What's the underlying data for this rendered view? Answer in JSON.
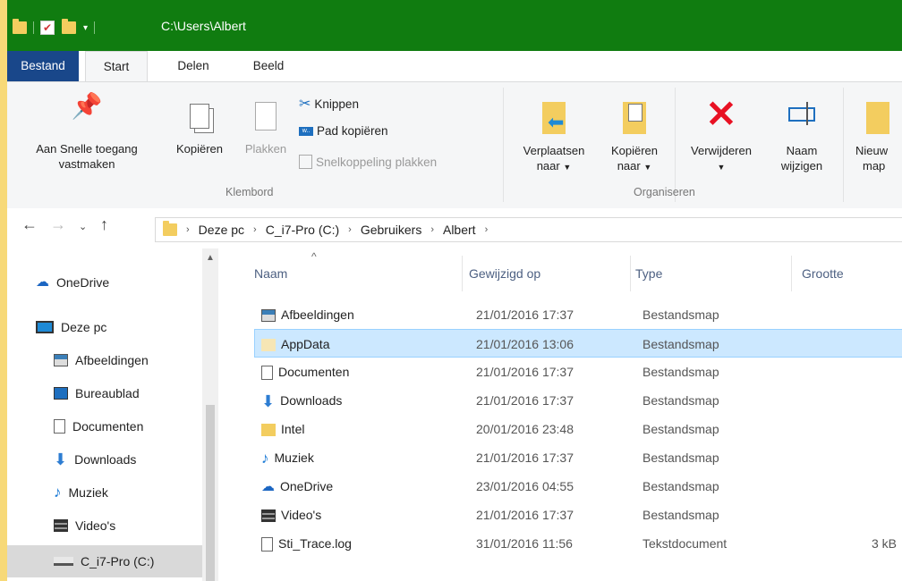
{
  "titlebar": {
    "path": "C:\\Users\\Albert"
  },
  "tabs": [
    {
      "label": "Bestand"
    },
    {
      "label": "Start"
    },
    {
      "label": "Delen"
    },
    {
      "label": "Beeld"
    }
  ],
  "ribbon": {
    "pin": {
      "line1": "Aan Snelle toegang",
      "line2": "vastmaken"
    },
    "copy": {
      "label": "Kopiëren"
    },
    "paste": {
      "label": "Plakken"
    },
    "cut": {
      "label": "Knippen"
    },
    "copy_path": {
      "label": "Pad kopiëren"
    },
    "paste_shortcut": {
      "label": "Snelkoppeling plakken"
    },
    "group_clipboard": "Klembord",
    "move_to": {
      "line1": "Verplaatsen",
      "line2": "naar"
    },
    "copy_to": {
      "line1": "Kopiëren",
      "line2": "naar"
    },
    "delete": {
      "line1": "Verwijderen"
    },
    "rename": {
      "line1": "Naam",
      "line2": "wijzigen"
    },
    "group_organize": "Organiseren",
    "new_folder": {
      "line1": "Nieuw",
      "line2": "map"
    }
  },
  "address": {
    "crumbs": [
      "Deze pc",
      "C_i7-Pro (C:)",
      "Gebruikers",
      "Albert"
    ]
  },
  "nav": {
    "items": [
      {
        "label": "OneDrive"
      },
      {
        "label": "Deze pc"
      },
      {
        "label": "Afbeeldingen"
      },
      {
        "label": "Bureaublad"
      },
      {
        "label": "Documenten"
      },
      {
        "label": "Downloads"
      },
      {
        "label": "Muziek"
      },
      {
        "label": "Video's"
      },
      {
        "label": "C_i7-Pro (C:)"
      }
    ]
  },
  "columns": {
    "name": "Naam",
    "modified": "Gewijzigd op",
    "type": "Type",
    "size": "Grootte"
  },
  "files": [
    {
      "name": "Afbeeldingen",
      "modified": "21/01/2016 17:37",
      "type": "Bestandsmap",
      "size": ""
    },
    {
      "name": "AppData",
      "modified": "21/01/2016 13:06",
      "type": "Bestandsmap",
      "size": ""
    },
    {
      "name": "Documenten",
      "modified": "21/01/2016 17:37",
      "type": "Bestandsmap",
      "size": ""
    },
    {
      "name": "Downloads",
      "modified": "21/01/2016 17:37",
      "type": "Bestandsmap",
      "size": ""
    },
    {
      "name": "Intel",
      "modified": "20/01/2016 23:48",
      "type": "Bestandsmap",
      "size": ""
    },
    {
      "name": "Muziek",
      "modified": "21/01/2016 17:37",
      "type": "Bestandsmap",
      "size": ""
    },
    {
      "name": "OneDrive",
      "modified": "23/01/2016 04:55",
      "type": "Bestandsmap",
      "size": ""
    },
    {
      "name": "Video's",
      "modified": "21/01/2016 17:37",
      "type": "Bestandsmap",
      "size": ""
    },
    {
      "name": "Sti_Trace.log",
      "modified": "31/01/2016 11:56",
      "type": "Tekstdocument",
      "size": "3 kB"
    }
  ]
}
